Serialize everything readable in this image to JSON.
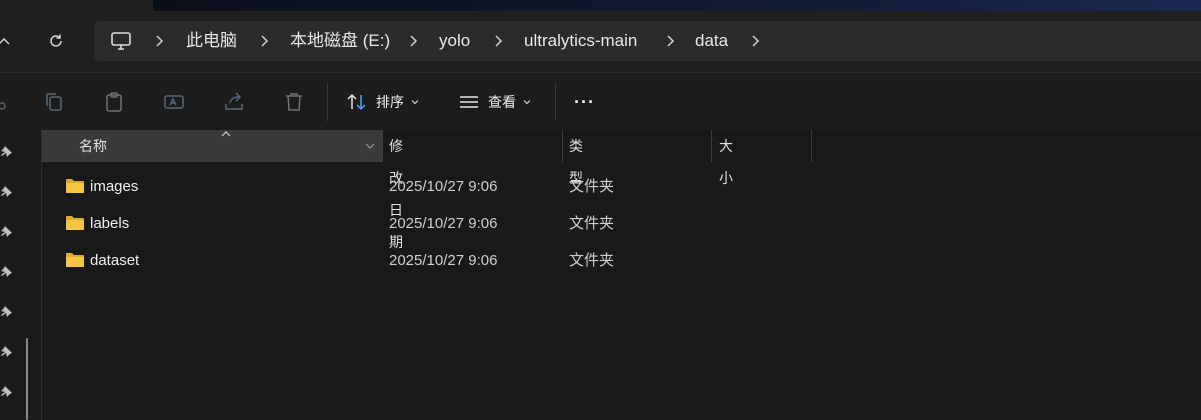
{
  "breadcrumb": [
    "此电脑",
    "本地磁盘 (E:)",
    "yolo",
    "ultralytics-main",
    "data"
  ],
  "toolbar": {
    "sort_label": "排序",
    "view_label": "查看",
    "more_label": "···"
  },
  "columns": {
    "name": "名称",
    "date": "修改日期",
    "type": "类型",
    "size": "大小"
  },
  "files": [
    {
      "name": "images",
      "date": "2025/10/27 9:06",
      "type": "文件夹"
    },
    {
      "name": "labels",
      "date": "2025/10/27 9:06",
      "type": "文件夹"
    },
    {
      "name": "dataset",
      "date": "2025/10/27 9:06",
      "type": "文件夹"
    }
  ],
  "colors": {
    "folder": "#f4c542",
    "folder_dark": "#e0a82e",
    "selected_header": "#3a3a3a",
    "sort_icon": "#4ea3ff"
  }
}
